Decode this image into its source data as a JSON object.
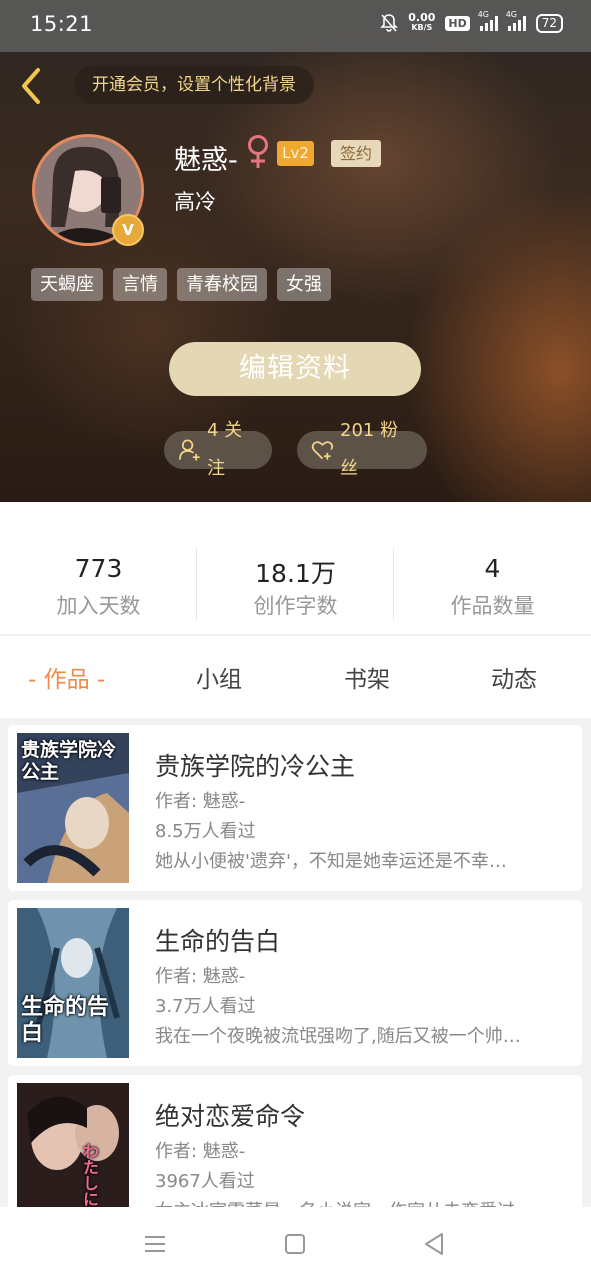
{
  "status_bar": {
    "time": "15:21",
    "net_speed": "0.00",
    "net_unit": "KB/S",
    "hd": "HD",
    "sig1": "4G",
    "sig2": "4G",
    "battery": "72"
  },
  "header": {
    "vip_prompt": "开通会员，设置个性化背景",
    "user_name": "魅惑-",
    "level": "Lv2",
    "signed_badge": "签约",
    "bio": "高冷",
    "tags": [
      "天蝎座",
      "言情",
      "青春校园",
      "女强"
    ],
    "edit_button": "编辑资料",
    "follow_label": "4 关注",
    "fans_label": "201 粉丝"
  },
  "stats": [
    {
      "value": "773",
      "label": "加入天数"
    },
    {
      "value": "18.1万",
      "label": "创作字数"
    },
    {
      "value": "4",
      "label": "作品数量"
    }
  ],
  "tabs": [
    "- 作品 -",
    "小组",
    "书架",
    "动态"
  ],
  "books": [
    {
      "title": "贵族学院的冷公主",
      "author": "作者: 魅惑-",
      "views": "8.5万人看过",
      "desc": "她从小便被'遗弃'，不知是她幸运还是不幸…",
      "cover_text": "贵族学院冷公主"
    },
    {
      "title": "生命的告白",
      "author": "作者: 魅惑-",
      "views": "3.7万人看过",
      "desc": "我在一个夜晚被流氓强吻了,随后又被一个帅…",
      "cover_text": "生命的告白"
    },
    {
      "title": "绝对恋爱命令",
      "author": "作者: 魅惑-",
      "views": "3967人看过",
      "desc": "女主冰室雪菜是一名小说家，作家从未恋爱过…",
      "cover_text": "わたしに"
    }
  ],
  "colors": {
    "accent": "#ef8a47",
    "vip_text": "#f3d68a",
    "level_badge": "#f0a830",
    "edit_button_bg": "#e4d7b4"
  }
}
